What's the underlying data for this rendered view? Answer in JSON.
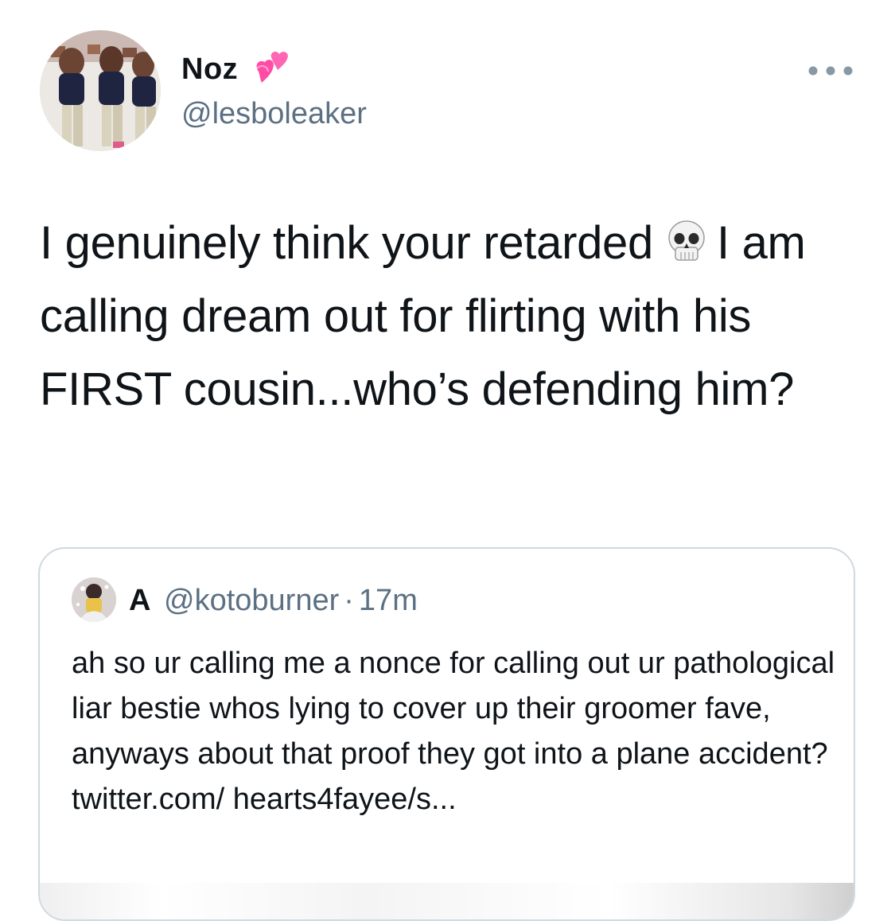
{
  "tweet": {
    "display_name": "Noz",
    "handle": "@lesboleaker",
    "text_part1": "I genuinely think your retarded",
    "text_part2": "I am calling dream out for flirting with his FIRST cousin...who’s defending him?",
    "emoji_icons": [
      "heart-emoji-icon",
      "skull-emoji-icon"
    ]
  },
  "quote": {
    "display_name": "A",
    "handle": "@kotoburner",
    "separator": "·",
    "time": "17m",
    "text": "ah so ur calling me a nonce for calling out ur pathological liar bestie whos lying to cover up their groomer fave, anyways about that proof they got into a plane accident? twitter.com/ hearts4fayee/s..."
  },
  "colors": {
    "text": "#0f1419",
    "secondary": "#5b7083",
    "border": "#cfd9de",
    "heart": "#ff4da6"
  }
}
